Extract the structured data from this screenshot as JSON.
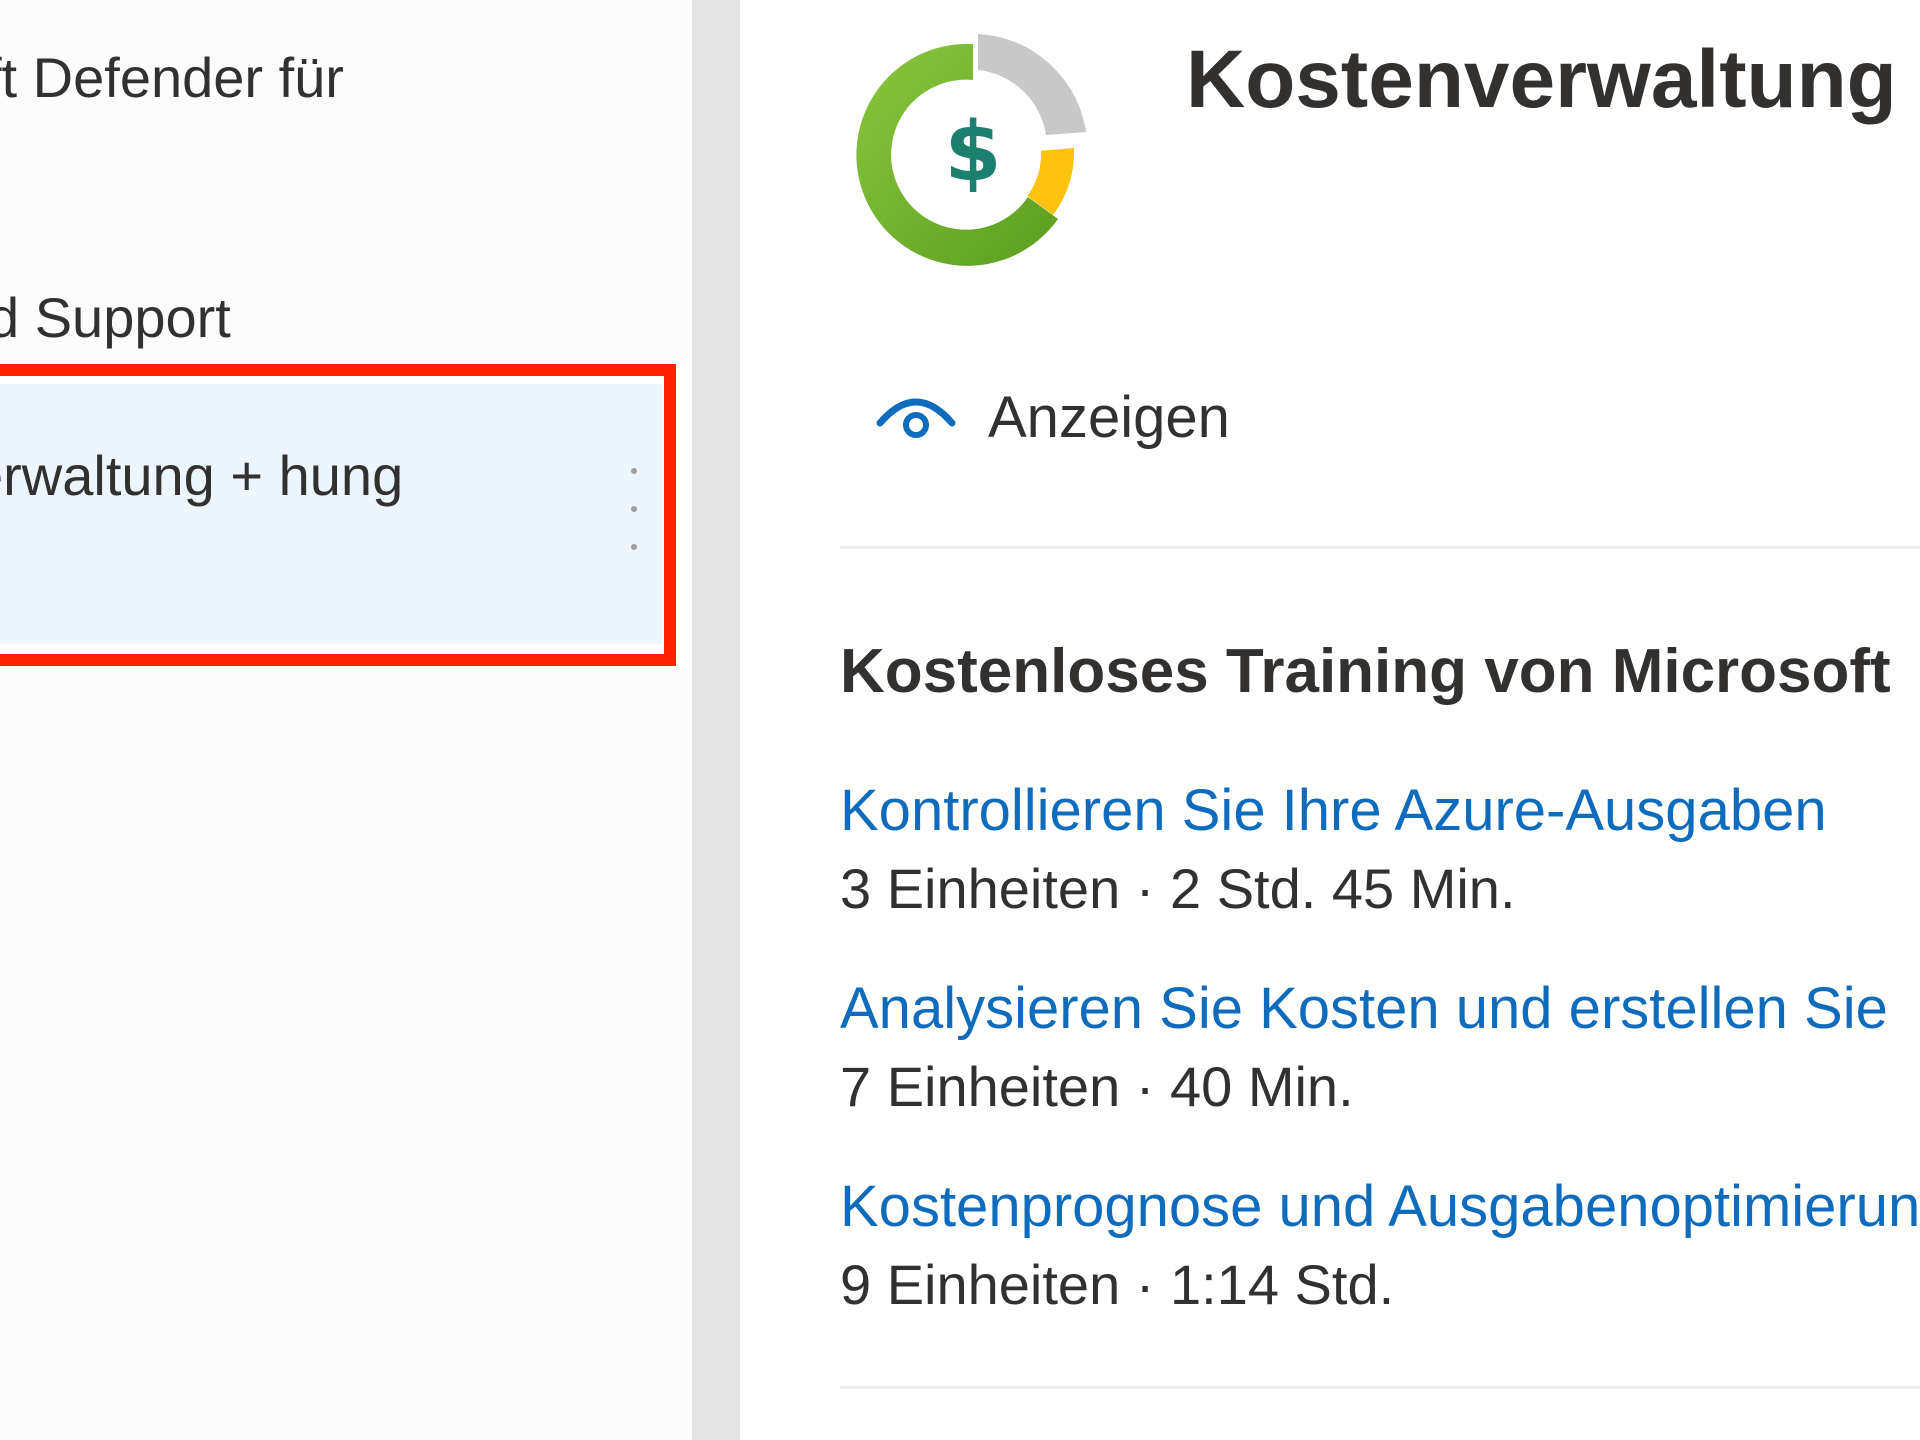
{
  "nav": {
    "items": [
      {
        "label": "ft Defender für"
      },
      {
        "label": "d Support"
      },
      {
        "label": "erwaltung + hung"
      }
    ],
    "selected_more_icon": "more-vertical-icon"
  },
  "detail": {
    "icon": "cost-management-donut-dollar-icon",
    "title": "Kostenverwaltung + Abrechnung",
    "view_icon": "eye-icon",
    "view_label": "Anzeigen",
    "training_heading": "Kostenloses Training von Microsoft",
    "courses": [
      {
        "title": "Kontrollieren Sie Ihre Azure-Ausgaben",
        "meta": "3 Einheiten · 2 Std. 45 Min."
      },
      {
        "title": "Analysieren Sie Kosten und erstellen Sie",
        "meta": "7 Einheiten · 40 Min."
      },
      {
        "title": "Kostenprognose und Ausgabenoptimierung",
        "meta": "9 Einheiten · 1:14 Std."
      }
    ]
  },
  "colors": {
    "link": "#0f6cbd",
    "selected_bg": "#edf5fe",
    "highlight": "#ff2200",
    "splitter": "#e4e4e4"
  }
}
